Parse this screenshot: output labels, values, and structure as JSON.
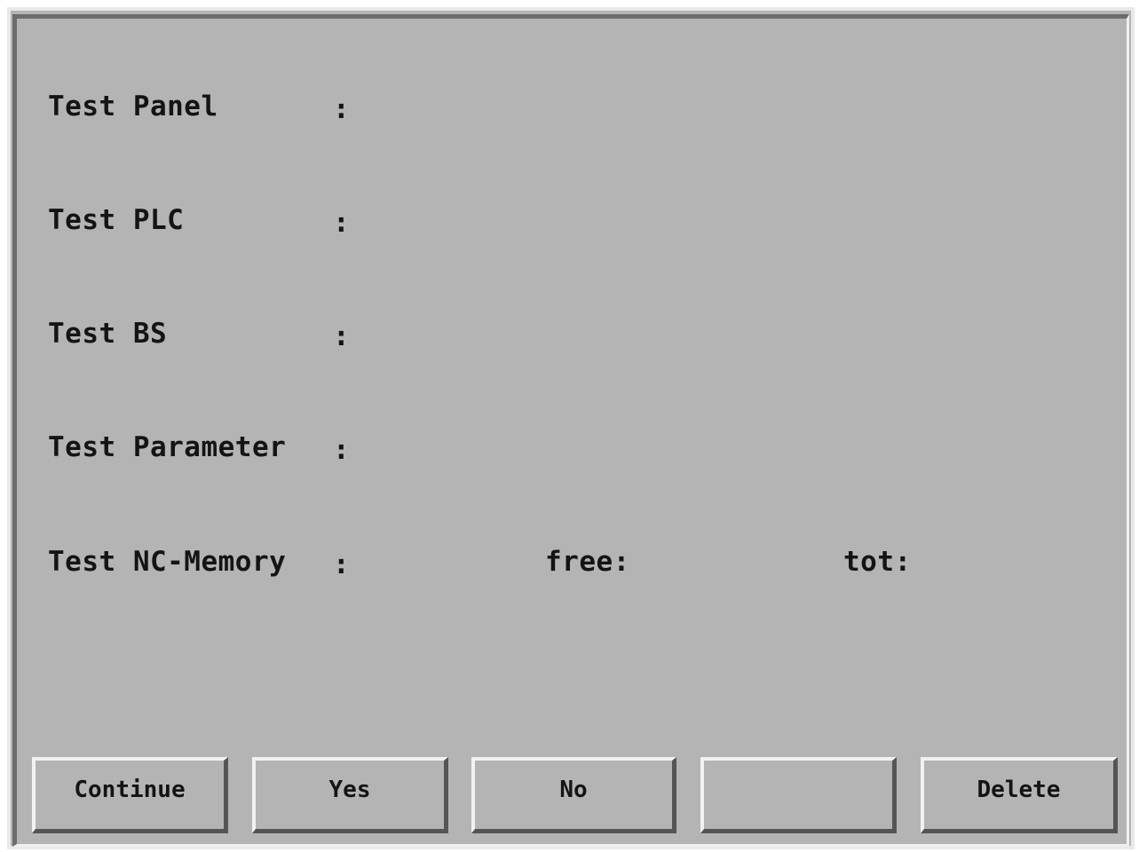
{
  "rows": [
    {
      "label": "Test Panel",
      "colon": ":"
    },
    {
      "label": "Test PLC",
      "colon": ":"
    },
    {
      "label": "Test BS",
      "colon": ":"
    },
    {
      "label": "Test Parameter",
      "colon": ":"
    },
    {
      "label": "Test NC-Memory",
      "colon": ":"
    }
  ],
  "memory": {
    "free_label": "free:",
    "tot_label": "tot:"
  },
  "softkeys": {
    "continue": "Continue",
    "yes": "Yes",
    "no": "No",
    "empty": "",
    "delete": "Delete"
  },
  "colors": {
    "background": "#b4b4b4",
    "text": "#141414"
  }
}
